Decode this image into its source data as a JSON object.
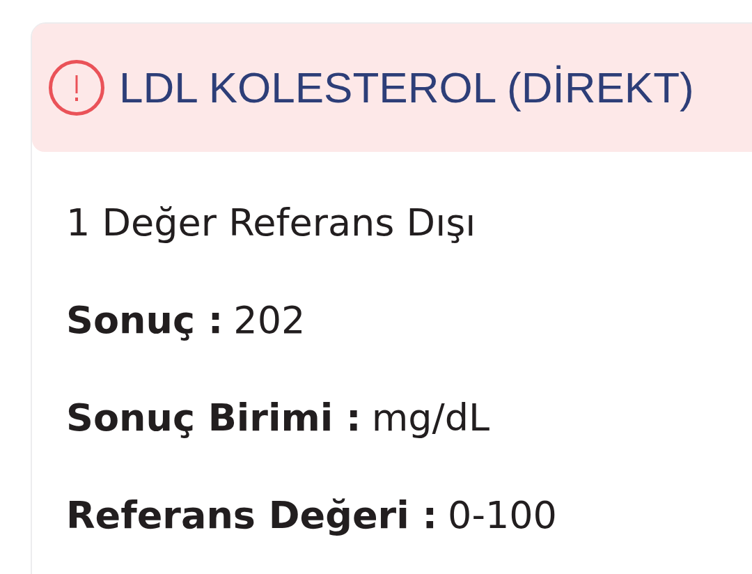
{
  "test": {
    "title": "LDL KOLESTEROL (DİREKT)",
    "out_of_range": true
  },
  "summary": "1 Değer Referans Dışı",
  "fields": [
    {
      "label": "Sonuç :",
      "value": "202"
    },
    {
      "label": "Sonuç Birimi :",
      "value": "mg/dL"
    },
    {
      "label": "Referans Değeri :",
      "value": "0-100"
    }
  ]
}
